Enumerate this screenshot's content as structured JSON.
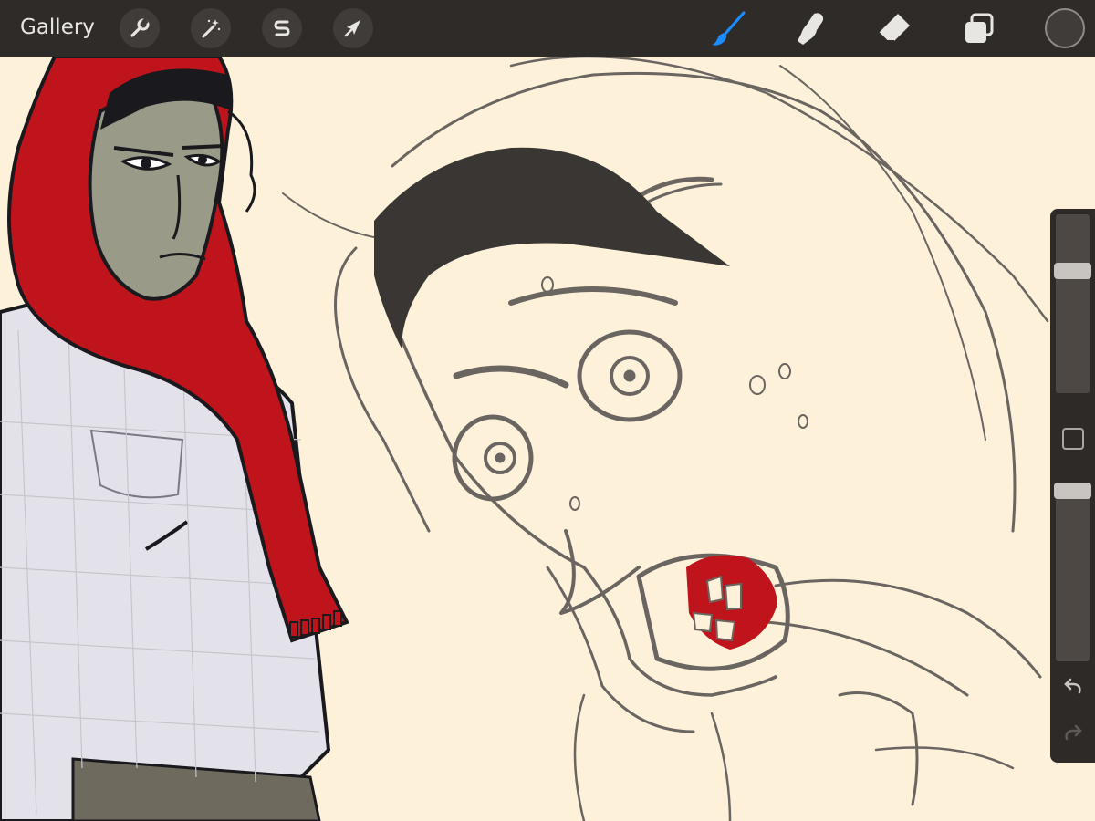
{
  "app": {
    "gallery_label": "Gallery"
  },
  "toolbar": {
    "left_tools": [
      {
        "name": "actions",
        "icon": "wrench-icon"
      },
      {
        "name": "adjustments",
        "icon": "magic-wand-icon"
      },
      {
        "name": "selection",
        "icon": "selection-s-icon"
      },
      {
        "name": "transform",
        "icon": "arrow-cursor-icon"
      }
    ],
    "right_tools": [
      {
        "name": "brush",
        "icon": "brush-icon",
        "active": true
      },
      {
        "name": "smudge",
        "icon": "smudge-finger-icon",
        "active": false
      },
      {
        "name": "eraser",
        "icon": "eraser-icon",
        "active": false
      },
      {
        "name": "layers",
        "icon": "layers-icon",
        "active": false
      }
    ],
    "active_color": "#3f3c39",
    "active_tool_color": "#1a8cff"
  },
  "sidebar": {
    "brush_size": 0.3,
    "brush_opacity": 0.0,
    "modify_icon": "square-modify-icon",
    "undo_icon": "undo-arrow-icon",
    "redo_icon": "redo-arrow-icon"
  },
  "colors": {
    "toolbar_bg": "#2e2b28",
    "canvas_bg": "#fdf1da",
    "scarf_red": "#c0141c",
    "sketch_gray": "#6b6561"
  }
}
